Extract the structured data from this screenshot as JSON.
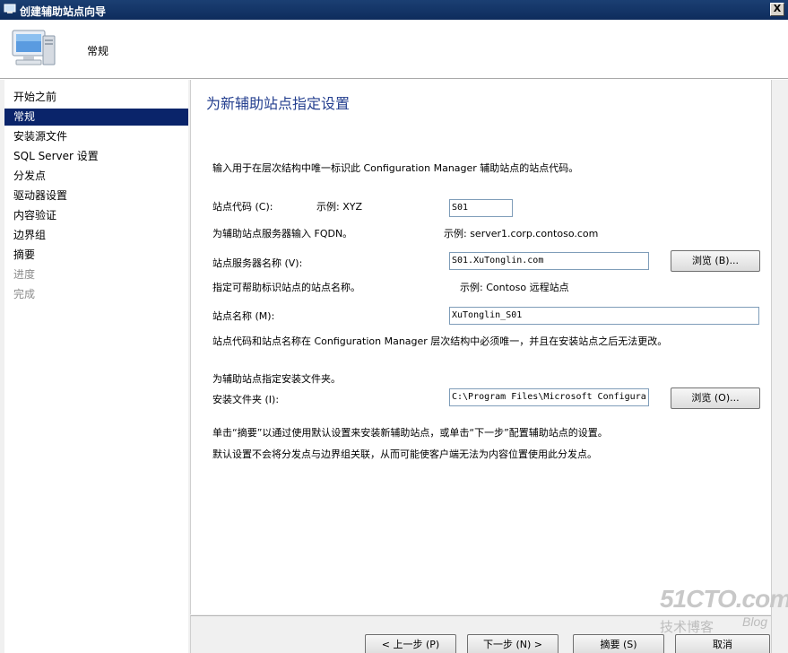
{
  "window": {
    "title": "创建辅助站点向导",
    "close_label": "X"
  },
  "header": {
    "title": "常规"
  },
  "nav": {
    "items": [
      {
        "label": "开始之前",
        "state": "normal"
      },
      {
        "label": "常规",
        "state": "active"
      },
      {
        "label": "安装源文件",
        "state": "normal"
      },
      {
        "label": "SQL Server 设置",
        "state": "normal"
      },
      {
        "label": "分发点",
        "state": "normal"
      },
      {
        "label": "驱动器设置",
        "state": "normal"
      },
      {
        "label": "内容验证",
        "state": "normal"
      },
      {
        "label": "边界组",
        "state": "normal"
      },
      {
        "label": "摘要",
        "state": "normal"
      },
      {
        "label": "进度",
        "state": "disabled"
      },
      {
        "label": "完成",
        "state": "disabled"
      }
    ]
  },
  "page": {
    "title": "为新辅助站点指定设置",
    "intro": "输入用于在层次结构中唯一标识此 Configuration Manager 辅助站点的站点代码。",
    "site_code_label": "站点代码 (C):",
    "site_code_example": "示例: XYZ",
    "site_code_value": "S01",
    "fqdn_hint": "为辅助站点服务器输入 FQDN。",
    "fqdn_example": "示例: server1.corp.contoso.com",
    "server_name_label": "站点服务器名称 (V):",
    "server_name_value": "S01.XuTonglin.com",
    "browse_b_label": "浏览 (B)...",
    "site_name_hint": "指定可帮助标识站点的站点名称。",
    "site_name_example": "示例: Contoso 远程站点",
    "site_name_label": "站点名称 (M):",
    "site_name_value": "XuTonglin_S01",
    "unique_note": "站点代码和站点名称在 Configuration Manager 层次结构中必须唯一，并且在安装站点之后无法更改。",
    "folder_hint": "为辅助站点指定安装文件夹。",
    "folder_label": "安装文件夹 (I):",
    "folder_value": "C:\\Program Files\\Microsoft Configura",
    "browse_o_label": "浏览 (O)...",
    "note1": "单击“摘要”以通过使用默认设置来安装新辅助站点，或单击“下一步”配置辅助站点的设置。",
    "note2": "默认设置不会将分发点与边界组关联，从而可能使客户端无法为内容位置使用此分发点。"
  },
  "buttons": {
    "prev": "< 上一步 (P)",
    "next": "下一步 (N) >",
    "summary": "摘要 (S)",
    "cancel": "取消"
  },
  "watermark": {
    "site": "51CTO.com",
    "sub": "技术博客",
    "tag": "Blog"
  }
}
